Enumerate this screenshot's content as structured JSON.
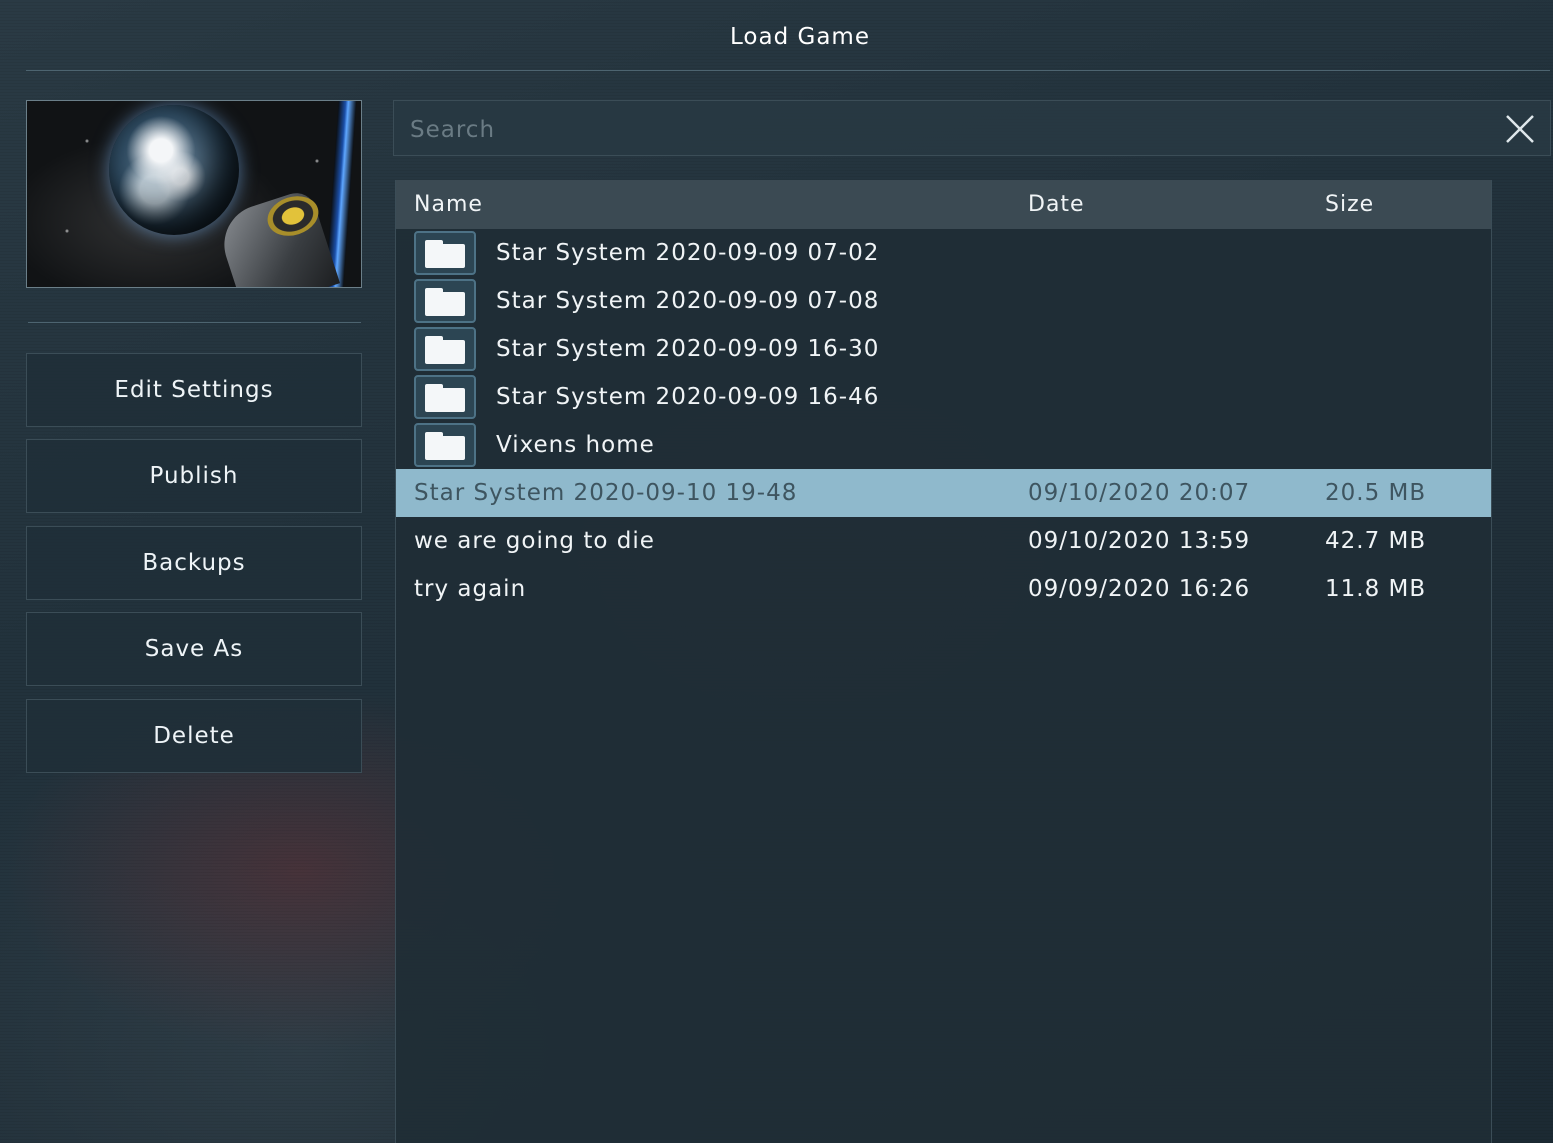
{
  "title": "Load Game",
  "buttons": {
    "edit_settings": "Edit Settings",
    "publish": "Publish",
    "backups": "Backups",
    "save_as": "Save As",
    "delete": "Delete"
  },
  "search": {
    "placeholder": "Search",
    "value": ""
  },
  "columns": {
    "name": "Name",
    "date": "Date",
    "size": "Size"
  },
  "folders": [
    {
      "name": "Star System 2020-09-09 07-02"
    },
    {
      "name": "Star System 2020-09-09 07-08"
    },
    {
      "name": "Star System 2020-09-09 16-30"
    },
    {
      "name": "Star System 2020-09-09 16-46"
    },
    {
      "name": "Vixens home"
    }
  ],
  "saves": [
    {
      "name": "Star System 2020-09-10 19-48",
      "date": "09/10/2020 20:07",
      "size": "20.5 MB",
      "selected": true
    },
    {
      "name": "we are going to die",
      "date": "09/10/2020 13:59",
      "size": "42.7 MB",
      "selected": false
    },
    {
      "name": "try again",
      "date": "09/09/2020 16:26",
      "size": "11.8 MB",
      "selected": false
    }
  ],
  "colors": {
    "selected_row": "#8fb9cc",
    "header_bg": "#3b4a53",
    "panel_bg": "#1f2d36"
  },
  "icons": {
    "folder": "folder-icon",
    "close": "close-icon",
    "preview": "save-preview-thumbnail"
  }
}
